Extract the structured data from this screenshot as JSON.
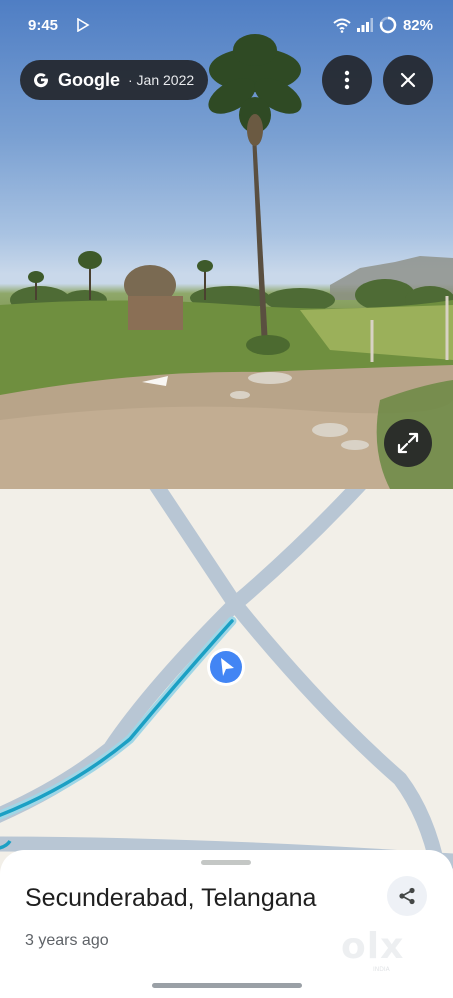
{
  "status_bar": {
    "time": "9:45",
    "battery": "82%",
    "icons": [
      "play-store-icon",
      "wifi-icon",
      "signal-icon",
      "battery-ring-icon"
    ]
  },
  "street_view": {
    "brand": "Google",
    "date": "· Jan 2022",
    "more_icon": "more-vert-icon",
    "close_icon": "close-icon",
    "expand_icon": "expand-icon"
  },
  "map": {
    "marker_color": "#4285f4",
    "route_color": "#1ba0c4",
    "road_color": "#b8c6d4"
  },
  "place": {
    "title": "Secunderabad, Telangana",
    "subtitle": "3 years ago",
    "share_icon": "share-icon"
  },
  "watermark": {
    "text": "olx",
    "sub": "INDIA"
  }
}
